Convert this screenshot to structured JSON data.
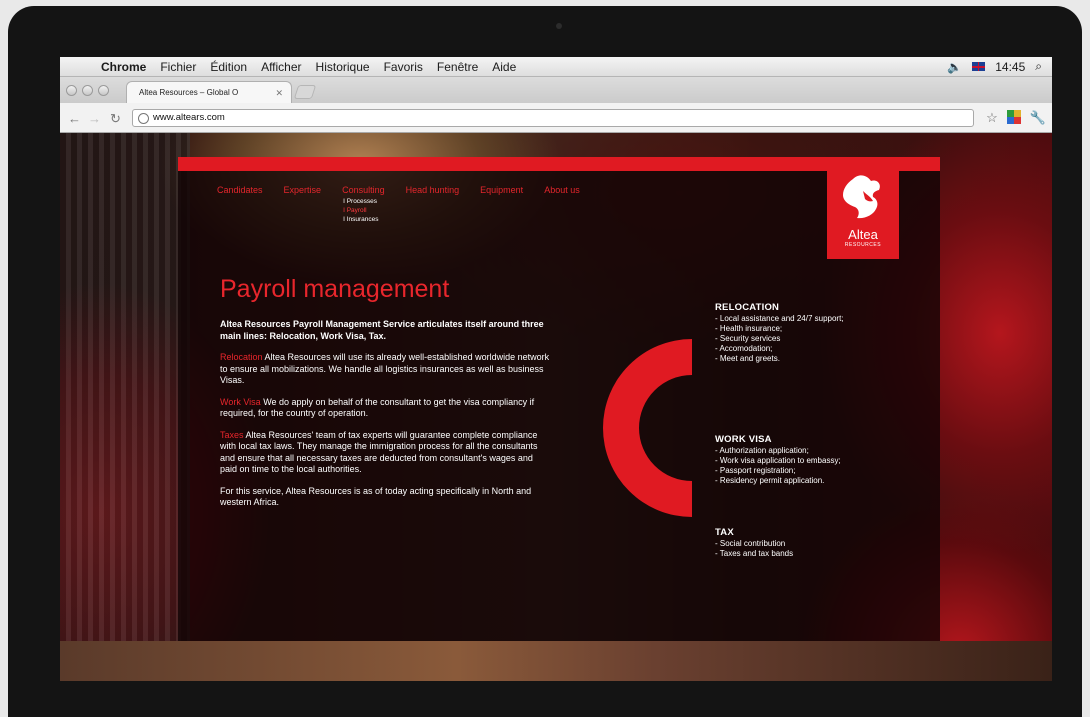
{
  "menubar": {
    "app": "Chrome",
    "items": [
      "Fichier",
      "Édition",
      "Afficher",
      "Historique",
      "Favoris",
      "Fenêtre",
      "Aide"
    ],
    "clock": "14:45"
  },
  "browser": {
    "tab_title": "Altea Resources – Global O",
    "url": "www.altears.com"
  },
  "site": {
    "nav": [
      {
        "label": "Candidates"
      },
      {
        "label": "Expertise"
      },
      {
        "label": "Consulting",
        "submenu": [
          "I Processes",
          "I Payroll",
          "I Insurances"
        ]
      },
      {
        "label": "Head hunting"
      },
      {
        "label": "Equipment"
      },
      {
        "label": "About us"
      }
    ],
    "logo": {
      "name": "Altea",
      "sub": "RESOURCES"
    },
    "title": "Payroll management",
    "intro": "Altea Resources Payroll Management Service articulates itself around three main lines: Relocation, Work Visa, Tax.",
    "sections": [
      {
        "keyword": "Relocation",
        "text": " Altea Resources will use its already well-established worldwide network to ensure all mobilizations. We handle all logistics insurances as well as business Visas."
      },
      {
        "keyword": "Work Visa",
        "text": " We do apply on behalf of the consultant to get the visa compliancy if required, for the country of operation."
      },
      {
        "keyword": "Taxes",
        "text": " Altea Resources' team of tax experts will guarantee complete compliance with local tax laws. They manage the immigration process for all the consultants and ensure that all necessary taxes are deducted from consultant's wages and paid on time to the local authorities."
      }
    ],
    "closing": "For this service, Altea Resources is as of today acting specifically in North and western Africa.",
    "relocation": {
      "heading": "RELOCATION",
      "items": [
        "- Local assistance and 24/7 support;",
        "- Health insurance;",
        "- Security services",
        "- Accomodation;",
        "- Meet and greets."
      ]
    },
    "workvisa": {
      "heading": "WORK VISA",
      "items": [
        "- Authorization application;",
        "- Work visa application to embassy;",
        "- Passport registration;",
        "- Residency permit application."
      ]
    },
    "tax": {
      "heading": "TAX",
      "items": [
        "- Social contribution",
        "- Taxes and tax bands"
      ]
    }
  },
  "colors": {
    "accent": "#e01a22"
  }
}
